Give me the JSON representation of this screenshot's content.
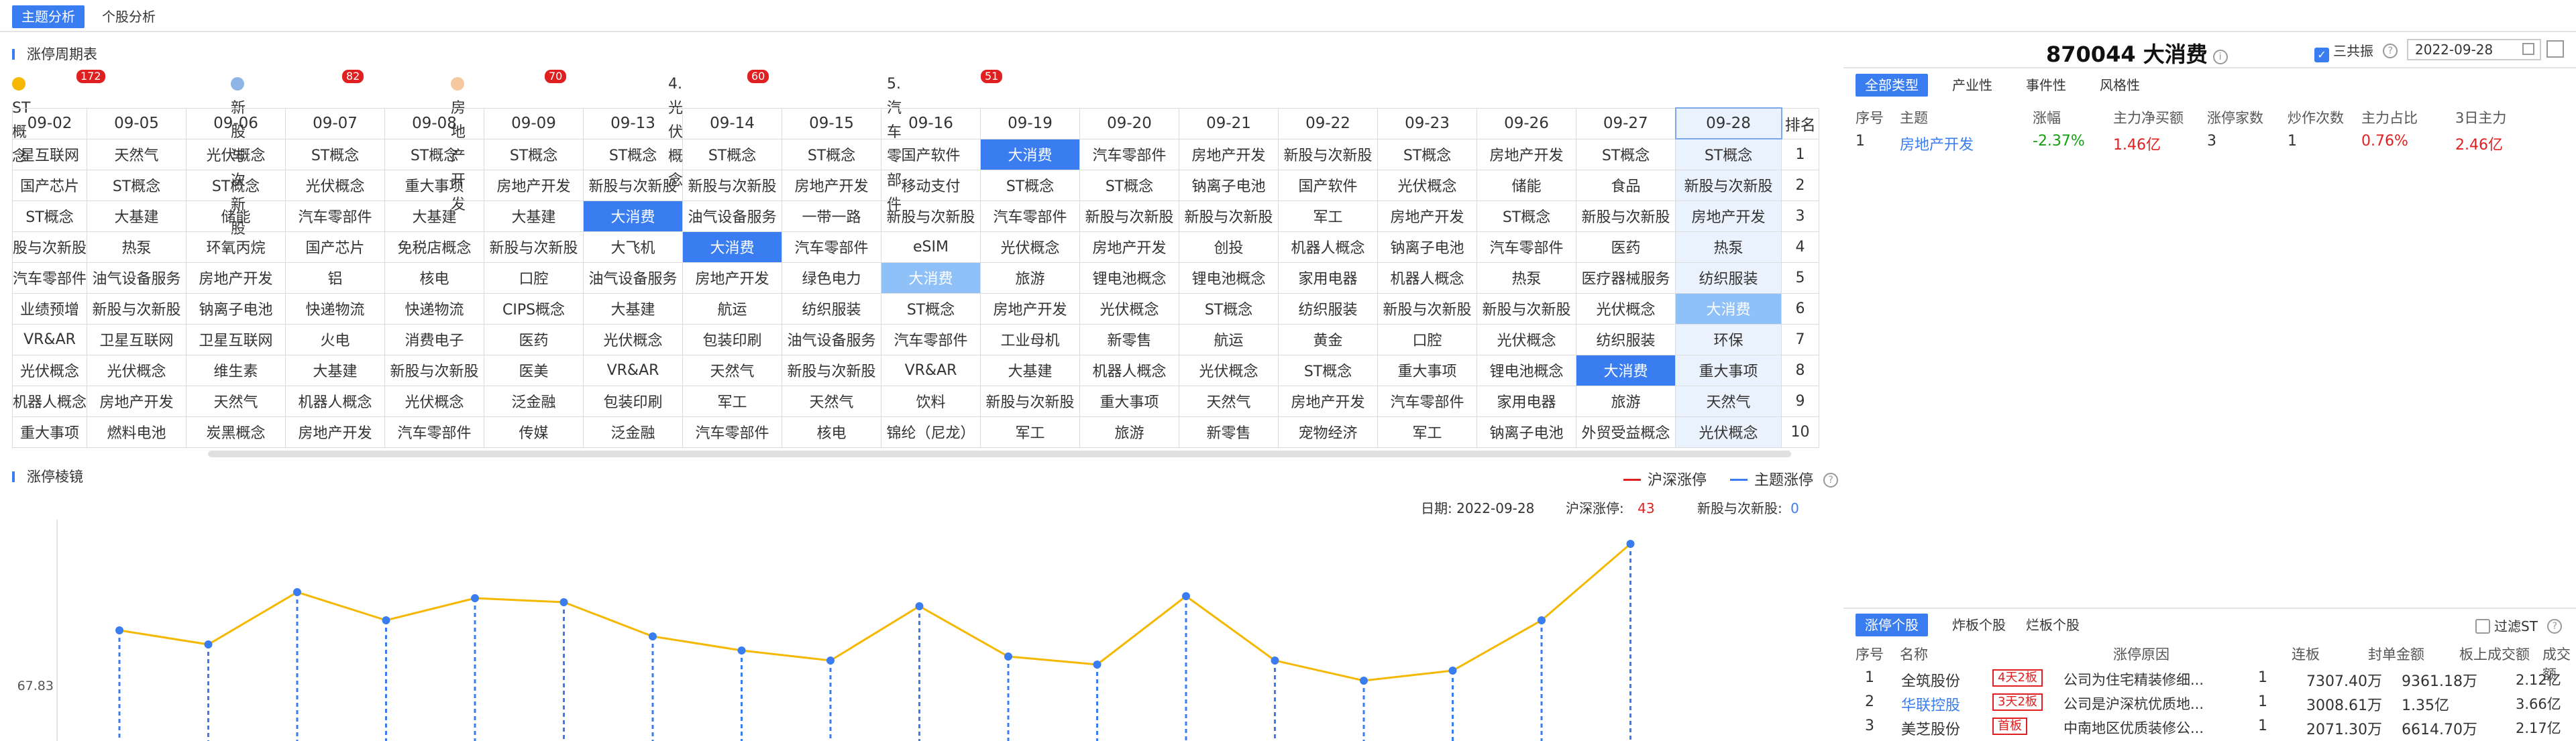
{
  "top_tabs": [
    "主题分析",
    "个股分析"
  ],
  "cycle_table": {
    "title": "涨停周期表",
    "legend": [
      {
        "label": "ST概念",
        "count": "172",
        "color": "#f5b800"
      },
      {
        "label": "新股与次新股",
        "count": "82",
        "color": "#8fb5e6"
      },
      {
        "label": "房地产开发",
        "count": "70",
        "color": "#f5c8a0"
      },
      {
        "label": "4. 光伏概念",
        "count": "60",
        "color": ""
      },
      {
        "label": "5. 汽车零部件",
        "count": "51",
        "color": ""
      }
    ],
    "dates": [
      "09-02",
      "09-05",
      "09-06",
      "09-07",
      "09-08",
      "09-09",
      "09-13",
      "09-14",
      "09-15",
      "09-16",
      "09-19",
      "09-20",
      "09-21",
      "09-22",
      "09-23",
      "09-26",
      "09-27",
      "09-28"
    ],
    "rank_header": "排名",
    "rows": [
      [
        "星互联网",
        "天然气",
        "光伏概念",
        "ST概念",
        "ST概念",
        "ST概念",
        "ST概念",
        "ST概念",
        "ST概念",
        "国产软件",
        "大消费",
        "汽车零部件",
        "房地产开发",
        "新股与次新股",
        "ST概念",
        "房地产开发",
        "ST概念",
        "ST概念"
      ],
      [
        "国产芯片",
        "ST概念",
        "ST概念",
        "光伏概念",
        "重大事项",
        "房地产开发",
        "新股与次新股",
        "新股与次新股",
        "房地产开发",
        "移动支付",
        "ST概念",
        "ST概念",
        "钠离子电池",
        "国产软件",
        "光伏概念",
        "储能",
        "食品",
        "新股与次新股"
      ],
      [
        "ST概念",
        "大基建",
        "储能",
        "汽车零部件",
        "大基建",
        "大基建",
        "大消费",
        "油气设备服务",
        "一带一路",
        "新股与次新股",
        "汽车零部件",
        "新股与次新股",
        "新股与次新股",
        "军工",
        "房地产开发",
        "ST概念",
        "新股与次新股",
        "房地产开发"
      ],
      [
        "股与次新股",
        "热泵",
        "环氧丙烷",
        "国产芯片",
        "免税店概念",
        "新股与次新股",
        "大飞机",
        "大消费",
        "汽车零部件",
        "eSIM",
        "光伏概念",
        "房地产开发",
        "创投",
        "机器人概念",
        "钠离子电池",
        "汽车零部件",
        "医药",
        "热泵"
      ],
      [
        "汽车零部件",
        "油气设备服务",
        "房地产开发",
        "铝",
        "核电",
        "口腔",
        "油气设备服务",
        "房地产开发",
        "绿色电力",
        "大消费",
        "旅游",
        "锂电池概念",
        "锂电池概念",
        "家用电器",
        "机器人概念",
        "热泵",
        "医疗器械服务",
        "纺织服装"
      ],
      [
        "业绩预增",
        "新股与次新股",
        "钠离子电池",
        "快递物流",
        "快递物流",
        "CIPS概念",
        "大基建",
        "航运",
        "纺织服装",
        "ST概念",
        "房地产开发",
        "光伏概念",
        "ST概念",
        "纺织服装",
        "新股与次新股",
        "新股与次新股",
        "光伏概念",
        "大消费"
      ],
      [
        "VR&AR",
        "卫星互联网",
        "卫星互联网",
        "火电",
        "消费电子",
        "医药",
        "光伏概念",
        "包装印刷",
        "油气设备服务",
        "汽车零部件",
        "工业母机",
        "新零售",
        "航运",
        "黄金",
        "口腔",
        "光伏概念",
        "纺织服装",
        "环保"
      ],
      [
        "光伏概念",
        "光伏概念",
        "维生素",
        "大基建",
        "新股与次新股",
        "医美",
        "VR&AR",
        "天然气",
        "新股与次新股",
        "VR&AR",
        "大基建",
        "机器人概念",
        "光伏概念",
        "ST概念",
        "重大事项",
        "锂电池概念",
        "大消费",
        "重大事项"
      ],
      [
        "机器人概念",
        "房地产开发",
        "天然气",
        "机器人概念",
        "光伏概念",
        "泛金融",
        "包装印刷",
        "军工",
        "天然气",
        "饮料",
        "新股与次新股",
        "重大事项",
        "天然气",
        "房地产开发",
        "汽车零部件",
        "家用电器",
        "旅游",
        "天然气"
      ],
      [
        "重大事项",
        "燃料电池",
        "炭黑概念",
        "房地产开发",
        "汽车零部件",
        "传媒",
        "泛金融",
        "汽车零部件",
        "核电",
        "锦纶（尼龙）",
        "军工",
        "旅游",
        "新零售",
        "宠物经济",
        "军工",
        "钠离子电池",
        "外贸受益概念",
        "光伏概念"
      ]
    ],
    "ranks": [
      "1",
      "2",
      "3",
      "4",
      "5",
      "6",
      "7",
      "8",
      "9",
      "10"
    ]
  },
  "mirror_chart": {
    "title": "涨停棱镜",
    "legend": [
      "沪深涨停",
      "主题涨停"
    ],
    "legend_colors": [
      "#e02020",
      "#3a7df0"
    ],
    "date_label": "日期:",
    "date_value": "2022-09-28",
    "hs_label": "沪深涨停:",
    "hs_value": "43",
    "theme_label": "新股与次新股:",
    "theme_value": "0",
    "y_tick": "67.83"
  },
  "chart_data": {
    "type": "line",
    "title": "",
    "x": [
      "09-02",
      "09-05",
      "09-06",
      "09-07",
      "09-08",
      "09-09",
      "09-13",
      "09-14",
      "09-15",
      "09-16",
      "09-19",
      "09-20",
      "09-21",
      "09-22",
      "09-23",
      "09-26",
      "09-27",
      "09-28"
    ],
    "series": [
      {
        "name": "沪深涨停",
        "values": [
          55,
          48,
          74,
          60,
          71,
          69,
          52,
          45,
          40,
          67,
          42,
          38,
          72,
          40,
          30,
          35,
          60,
          98
        ]
      }
    ],
    "y_ticks": [
      "67.83"
    ],
    "ylim": [
      0,
      110
    ]
  },
  "right_panel": {
    "stock_code_name": "870044 大消费",
    "sanggong_label": "三共振",
    "date": "2022-09-28",
    "type_tabs": [
      "全部类型",
      "产业性",
      "事件性",
      "风格性"
    ],
    "theme_headers": [
      "序号",
      "主题",
      "涨幅",
      "主力净买额",
      "涨停家数",
      "炒作次数",
      "主力占比",
      "3日主力"
    ],
    "theme_rows": [
      [
        "1",
        "房地产开发",
        "-2.37%",
        "1.46亿",
        "3",
        "1",
        "0.76%",
        "2.46亿"
      ]
    ],
    "stock_tabs": [
      "涨停个股",
      "炸板个股",
      "烂板个股"
    ],
    "filter_st": "过滤ST",
    "stock_headers": [
      "序号",
      "名称",
      "涨停原因",
      "连板",
      "封单金额",
      "板上成交额",
      "成交额"
    ],
    "stock_rows": [
      [
        "1",
        "全筑股份",
        "4天2板",
        "公司为住宅精装修细...",
        "1",
        "7307.40万",
        "9361.18万",
        "2.12亿"
      ],
      [
        "2",
        "华联控股",
        "3天2板",
        "公司是沪深杭优质地...",
        "1",
        "3008.61万",
        "1.35亿",
        "3.66亿"
      ],
      [
        "3",
        "美芝股份",
        "首板",
        "中南地区优质装修公...",
        "1",
        "2071.30万",
        "6614.70万",
        "2.17亿"
      ]
    ]
  }
}
